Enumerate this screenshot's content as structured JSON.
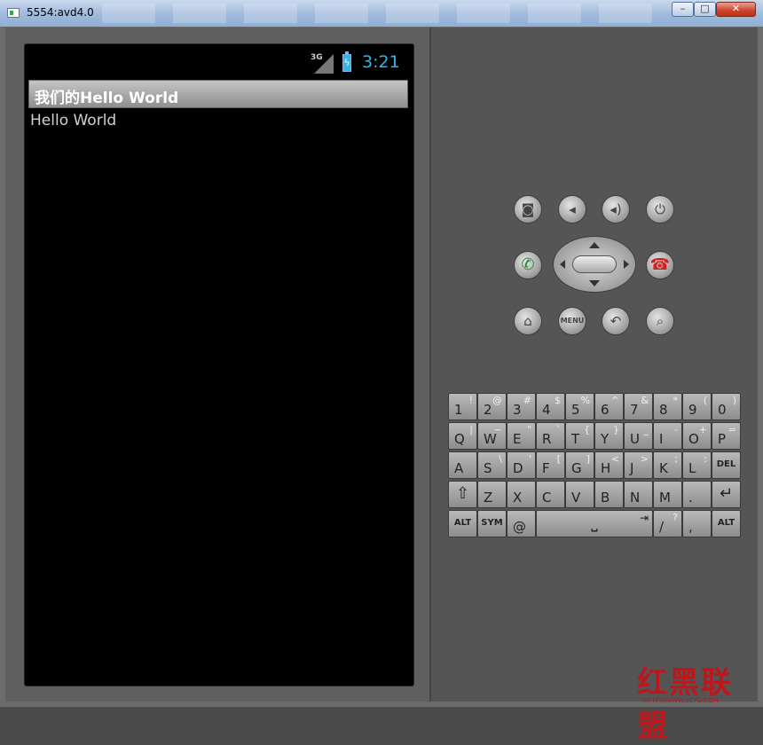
{
  "window": {
    "title": "5554:avd4.0"
  },
  "status_bar": {
    "network": "3G",
    "time": "3:21",
    "accent_color": "#33b5e5"
  },
  "app": {
    "title": "我们的Hello World",
    "body_text": "Hello World"
  },
  "hardware": {
    "camera_icon": "camera-icon",
    "volume_down_icon": "volume-down-icon",
    "volume_up_icon": "volume-up-icon",
    "power_icon": "power-icon",
    "call_icon": "call-icon",
    "end_call_icon": "end-call-icon",
    "home_icon": "home-icon",
    "menu_label": "MENU",
    "back_icon": "back-icon",
    "search_icon": "search-icon"
  },
  "keyboard": {
    "row1": [
      {
        "main": "1",
        "alt": "!"
      },
      {
        "main": "2",
        "alt": "@"
      },
      {
        "main": "3",
        "alt": "#"
      },
      {
        "main": "4",
        "alt": "$"
      },
      {
        "main": "5",
        "alt": "%"
      },
      {
        "main": "6",
        "alt": "^"
      },
      {
        "main": "7",
        "alt": "&"
      },
      {
        "main": "8",
        "alt": "*"
      },
      {
        "main": "9",
        "alt": "("
      },
      {
        "main": "0",
        "alt": ")"
      }
    ],
    "row2": [
      {
        "main": "Q",
        "alt": "|"
      },
      {
        "main": "W",
        "alt": "~"
      },
      {
        "main": "E",
        "alt": "\""
      },
      {
        "main": "R",
        "alt": "`"
      },
      {
        "main": "T",
        "alt": "{"
      },
      {
        "main": "Y",
        "alt": "}"
      },
      {
        "main": "U",
        "alt": "_"
      },
      {
        "main": "I",
        "alt": "-"
      },
      {
        "main": "O",
        "alt": "+"
      },
      {
        "main": "P",
        "alt": "="
      }
    ],
    "row3": [
      {
        "main": "A",
        "alt": ""
      },
      {
        "main": "S",
        "alt": "\\"
      },
      {
        "main": "D",
        "alt": "'"
      },
      {
        "main": "F",
        "alt": "["
      },
      {
        "main": "G",
        "alt": "]"
      },
      {
        "main": "H",
        "alt": "<"
      },
      {
        "main": "J",
        "alt": ">"
      },
      {
        "main": "K",
        "alt": ";"
      },
      {
        "main": "L",
        "alt": ":"
      },
      {
        "main": "DEL",
        "alt": ""
      }
    ],
    "row4": [
      {
        "main": "⇧",
        "alt": ""
      },
      {
        "main": "Z",
        "alt": ""
      },
      {
        "main": "X",
        "alt": ""
      },
      {
        "main": "C",
        "alt": ""
      },
      {
        "main": "V",
        "alt": ""
      },
      {
        "main": "B",
        "alt": ""
      },
      {
        "main": "N",
        "alt": ""
      },
      {
        "main": "M",
        "alt": ""
      },
      {
        "main": ".",
        "alt": ""
      },
      {
        "main": "↵",
        "alt": ""
      }
    ],
    "row5": {
      "alt_left": "ALT",
      "sym": "SYM",
      "at": "@",
      "space": "⎵",
      "tab": "⇥",
      "slash": "/",
      "slash_alt": "?",
      "comma": ",",
      "alt_right": "ALT"
    }
  },
  "watermark": {
    "text": "红黑联盟",
    "sub": "HTTP://WWW.2CTO.COM"
  }
}
